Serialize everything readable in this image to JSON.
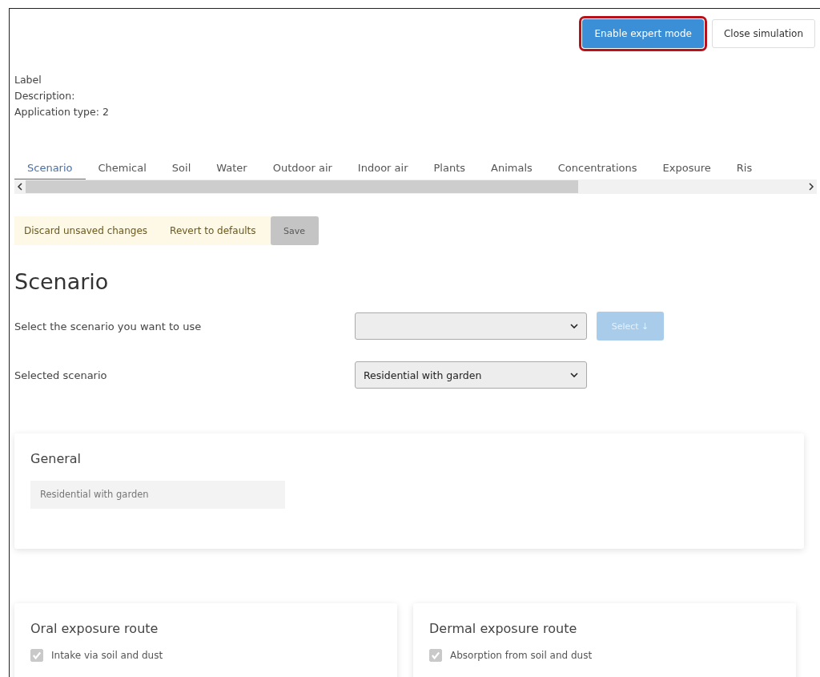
{
  "header_buttons": [
    {
      "label": "Enable expert mode",
      "kind": "primary",
      "highlighted": true
    },
    {
      "label": "Close simulation",
      "kind": "default",
      "highlighted": false
    }
  ],
  "info": [
    "Label",
    "Description:",
    "Application type: 2"
  ],
  "tabs": [
    {
      "label": "Scenario",
      "selected": true
    },
    {
      "label": "Chemical",
      "selected": false
    },
    {
      "label": "Soil",
      "selected": false
    },
    {
      "label": "Water",
      "selected": false
    },
    {
      "label": "Outdoor air",
      "selected": false
    },
    {
      "label": "Indoor air",
      "selected": false
    },
    {
      "label": "Plants",
      "selected": false
    },
    {
      "label": "Animals",
      "selected": false
    },
    {
      "label": "Concentrations",
      "selected": false
    },
    {
      "label": "Exposure",
      "selected": false
    },
    {
      "label": "Ris",
      "selected": false
    }
  ],
  "actions": {
    "discard": "Discard unsaved changes",
    "revert": "Revert to defaults",
    "save": {
      "label": "Save",
      "disabled": true
    }
  },
  "heading": "Scenario",
  "form_rows": [
    {
      "label": "Select the scenario you want to use",
      "value": "",
      "button": {
        "label": "Select ↓",
        "disabled": true
      }
    },
    {
      "label": "Selected scenario",
      "value": "Residential with garden"
    }
  ],
  "general": {
    "title": "General",
    "value": "Residential with garden"
  },
  "routes": [
    {
      "title": "Oral exposure route",
      "items": [
        {
          "label": "Intake via soil and dust",
          "checked": true,
          "disabled": true
        }
      ]
    },
    {
      "title": "Dermal exposure route",
      "items": [
        {
          "label": "Absorption from soil and dust",
          "checked": true,
          "disabled": true
        }
      ]
    }
  ]
}
